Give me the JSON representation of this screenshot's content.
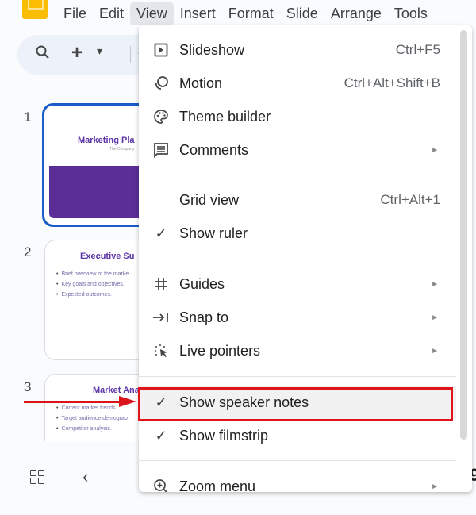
{
  "app": {
    "logo": "google-slides-logo"
  },
  "menubar": {
    "items": [
      {
        "label": "File"
      },
      {
        "label": "Edit"
      },
      {
        "label": "View",
        "active": true
      },
      {
        "label": "Insert"
      },
      {
        "label": "Format"
      },
      {
        "label": "Slide"
      },
      {
        "label": "Arrange"
      },
      {
        "label": "Tools"
      }
    ]
  },
  "toolbar": {
    "search_icon": "⚲",
    "new_slide_icon": "+",
    "dropdown_icon": "▾",
    "undo_icon": "↶"
  },
  "filmstrip": {
    "slides": [
      {
        "number": "1",
        "title": "Marketing Pla",
        "subtitle": "The Company",
        "selected": true
      },
      {
        "number": "2",
        "title": "Executive Su",
        "bullets": [
          "Brief overview of the marke",
          "Key goals and objectives.",
          "Expected outcomes."
        ]
      },
      {
        "number": "3",
        "title": "Market Ana",
        "bullets": [
          "Current market trends.",
          "Target audience demograp",
          "Competitor analysis."
        ]
      }
    ]
  },
  "bottombar": {
    "grid_icon": "grid-view",
    "prev_icon": "‹"
  },
  "view_menu": {
    "items": [
      {
        "label": "Slideshow",
        "shortcut": "Ctrl+F5",
        "icon": "▶"
      },
      {
        "label": "Motion",
        "shortcut": "Ctrl+Alt+Shift+B",
        "icon": "◎"
      },
      {
        "label": "Theme builder",
        "shortcut": "",
        "icon": "🎨"
      },
      {
        "label": "Comments",
        "submenu": "►",
        "icon": "☰"
      },
      {
        "label": "Grid view",
        "shortcut": "Ctrl+Alt+1",
        "icon": ""
      },
      {
        "label": "Show ruler",
        "checked": true,
        "icon": "✓"
      },
      {
        "label": "Guides",
        "submenu": "►",
        "icon": "#"
      },
      {
        "label": "Snap to",
        "submenu": "►",
        "icon": "→|"
      },
      {
        "label": "Live pointers",
        "submenu": "►",
        "icon": "⁘"
      },
      {
        "label": "Show speaker notes",
        "checked": true,
        "icon": "✓",
        "highlighted": true
      },
      {
        "label": "Show filmstrip",
        "checked": true,
        "icon": "✓"
      },
      {
        "label": "Zoom menu",
        "submenu": "►",
        "icon": "⊕"
      }
    ]
  },
  "annotation": {
    "color": "#e0151c"
  },
  "colors": {
    "accent": "#1a5dc8",
    "slide_purple": "#5b2d96",
    "logo_yellow": "#fbbc04"
  }
}
